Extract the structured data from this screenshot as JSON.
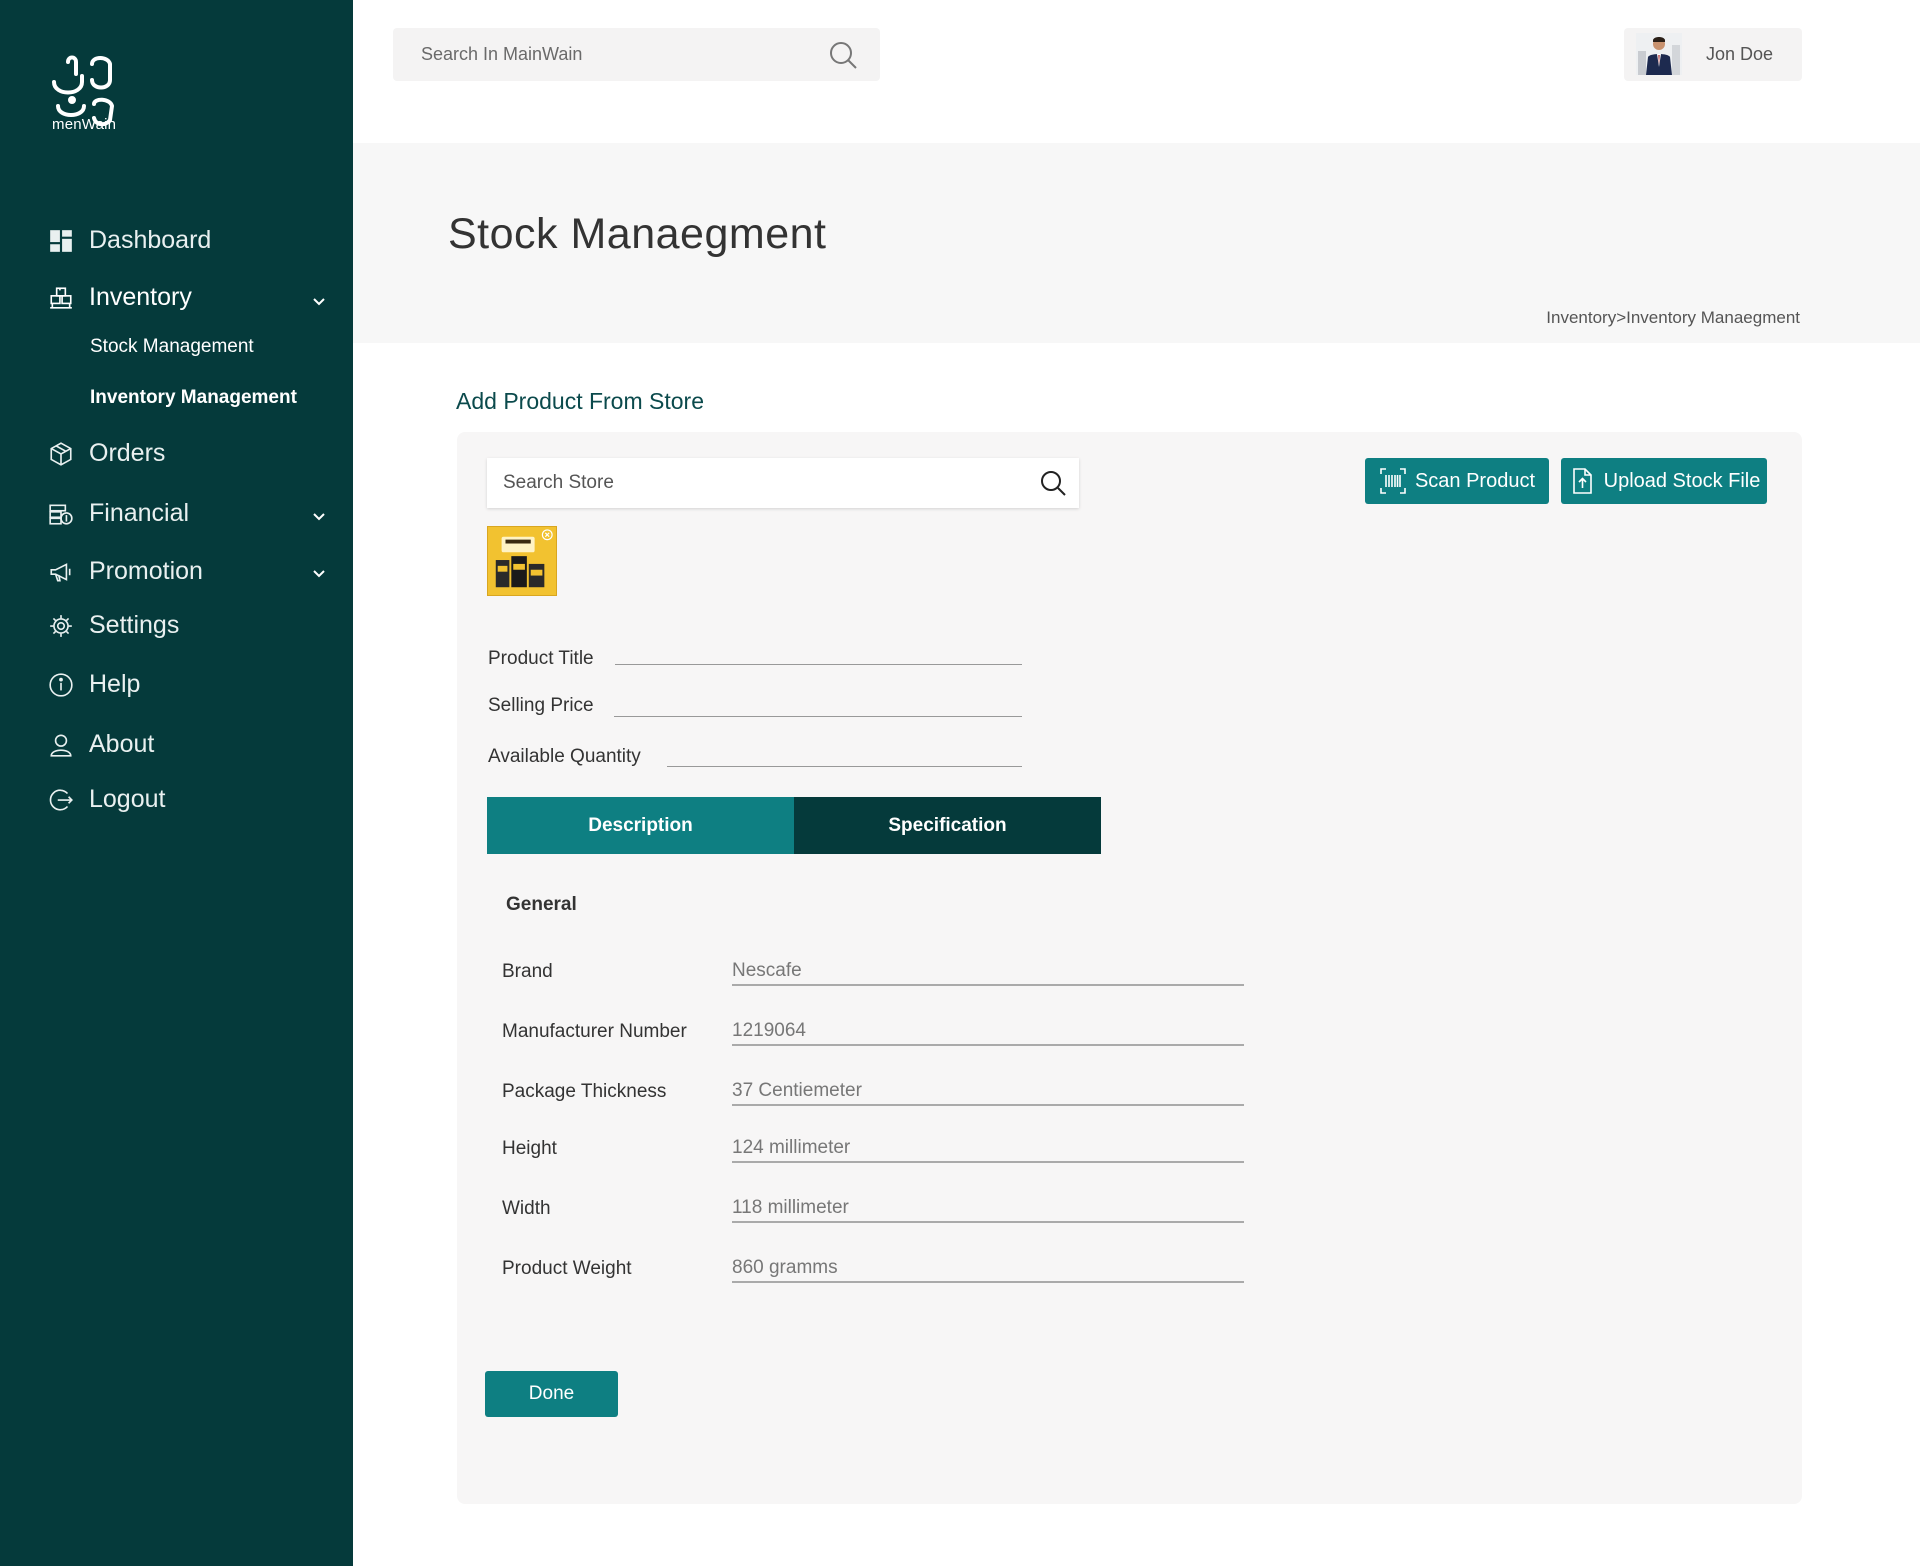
{
  "app": {
    "logo_text": "menWain"
  },
  "sidebar": {
    "items": [
      {
        "label": "Dashboard",
        "icon": "dashboard-icon"
      },
      {
        "label": "Inventory",
        "icon": "boxes-icon",
        "expanded": true,
        "children": [
          "Stock Management",
          "Inventory Management"
        ]
      },
      {
        "label": "Orders",
        "icon": "package-icon"
      },
      {
        "label": "Financial",
        "icon": "money-icon"
      },
      {
        "label": "Promotion",
        "icon": "megaphone-icon"
      },
      {
        "label": "Settings",
        "icon": "gear-icon"
      },
      {
        "label": "Help",
        "icon": "info-icon"
      },
      {
        "label": "About",
        "icon": "user-icon"
      },
      {
        "label": "Logout",
        "icon": "logout-icon"
      }
    ]
  },
  "topbar": {
    "search_placeholder": "Search In MainWain",
    "user_name": "Jon Doe"
  },
  "header": {
    "title": "Stock Manaegment",
    "breadcrumb": "Inventory>Inventory Manaegment"
  },
  "main": {
    "section_title": "Add Product From Store",
    "store_search_placeholder": "Search Store",
    "scan_button": "Scan Product",
    "upload_button": "Upload Stock File",
    "fields": {
      "product_title": "Product Title",
      "selling_price": "Selling Price",
      "available_quantity": "Available Quantity"
    },
    "tabs": {
      "description": "Description",
      "specification": "Specification"
    },
    "spec_group": "General",
    "specs": [
      {
        "label": "Brand",
        "value": "Nescafe"
      },
      {
        "label": "Manufacturer Number",
        "value": "1219064"
      },
      {
        "label": "Package Thickness",
        "value": "37 Centiemeter"
      },
      {
        "label": "Height",
        "value": "124 millimeter"
      },
      {
        "label": "Width",
        "value": "118 millimeter"
      },
      {
        "label": "Product Weight",
        "value": "860 gramms"
      }
    ],
    "done_button": "Done"
  },
  "colors": {
    "sidebar_bg": "#053a3b",
    "accent_teal": "#0e7f82",
    "tab_dark": "#053a3b",
    "card_bg": "#f7f6f6"
  }
}
